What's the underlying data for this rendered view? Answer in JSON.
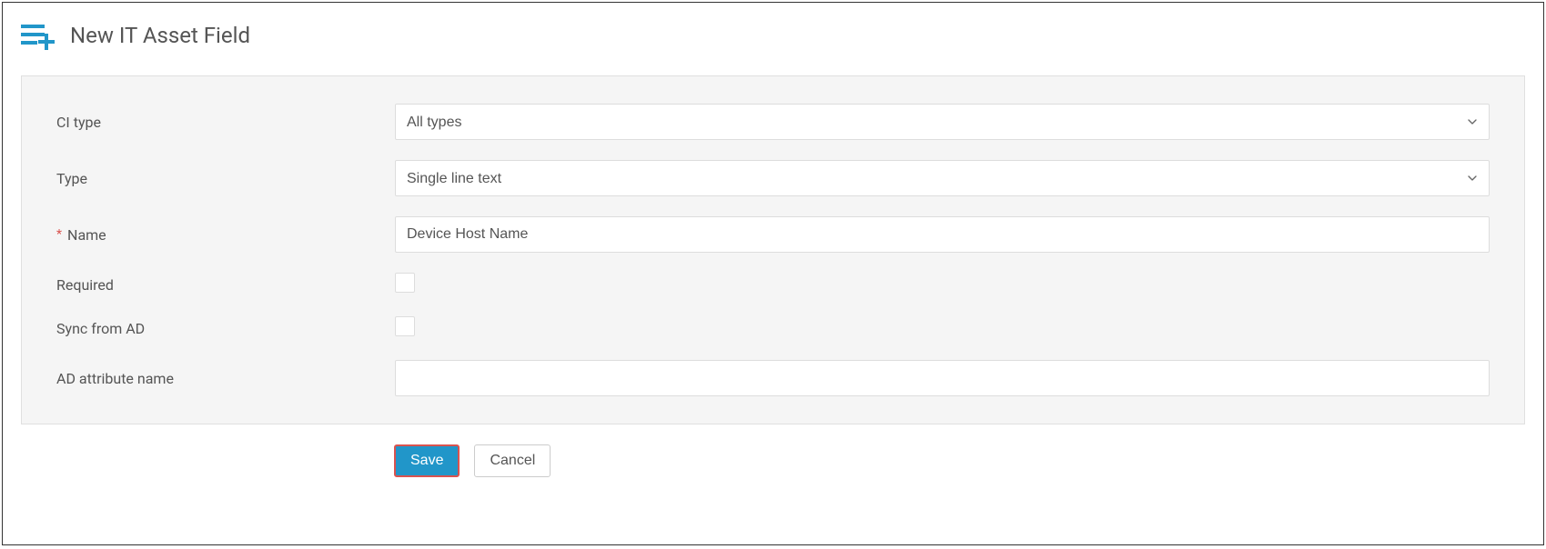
{
  "header": {
    "title": "New IT Asset Field"
  },
  "form": {
    "ci_type": {
      "label": "CI type",
      "value": "All types"
    },
    "type": {
      "label": "Type",
      "value": "Single line text"
    },
    "name": {
      "label": "Name",
      "required_marker": "*",
      "value": "Device Host Name"
    },
    "required": {
      "label": "Required",
      "checked": false
    },
    "sync_from_ad": {
      "label": "Sync from AD",
      "checked": false
    },
    "ad_attribute_name": {
      "label": "AD attribute name",
      "value": ""
    }
  },
  "buttons": {
    "save": "Save",
    "cancel": "Cancel"
  }
}
